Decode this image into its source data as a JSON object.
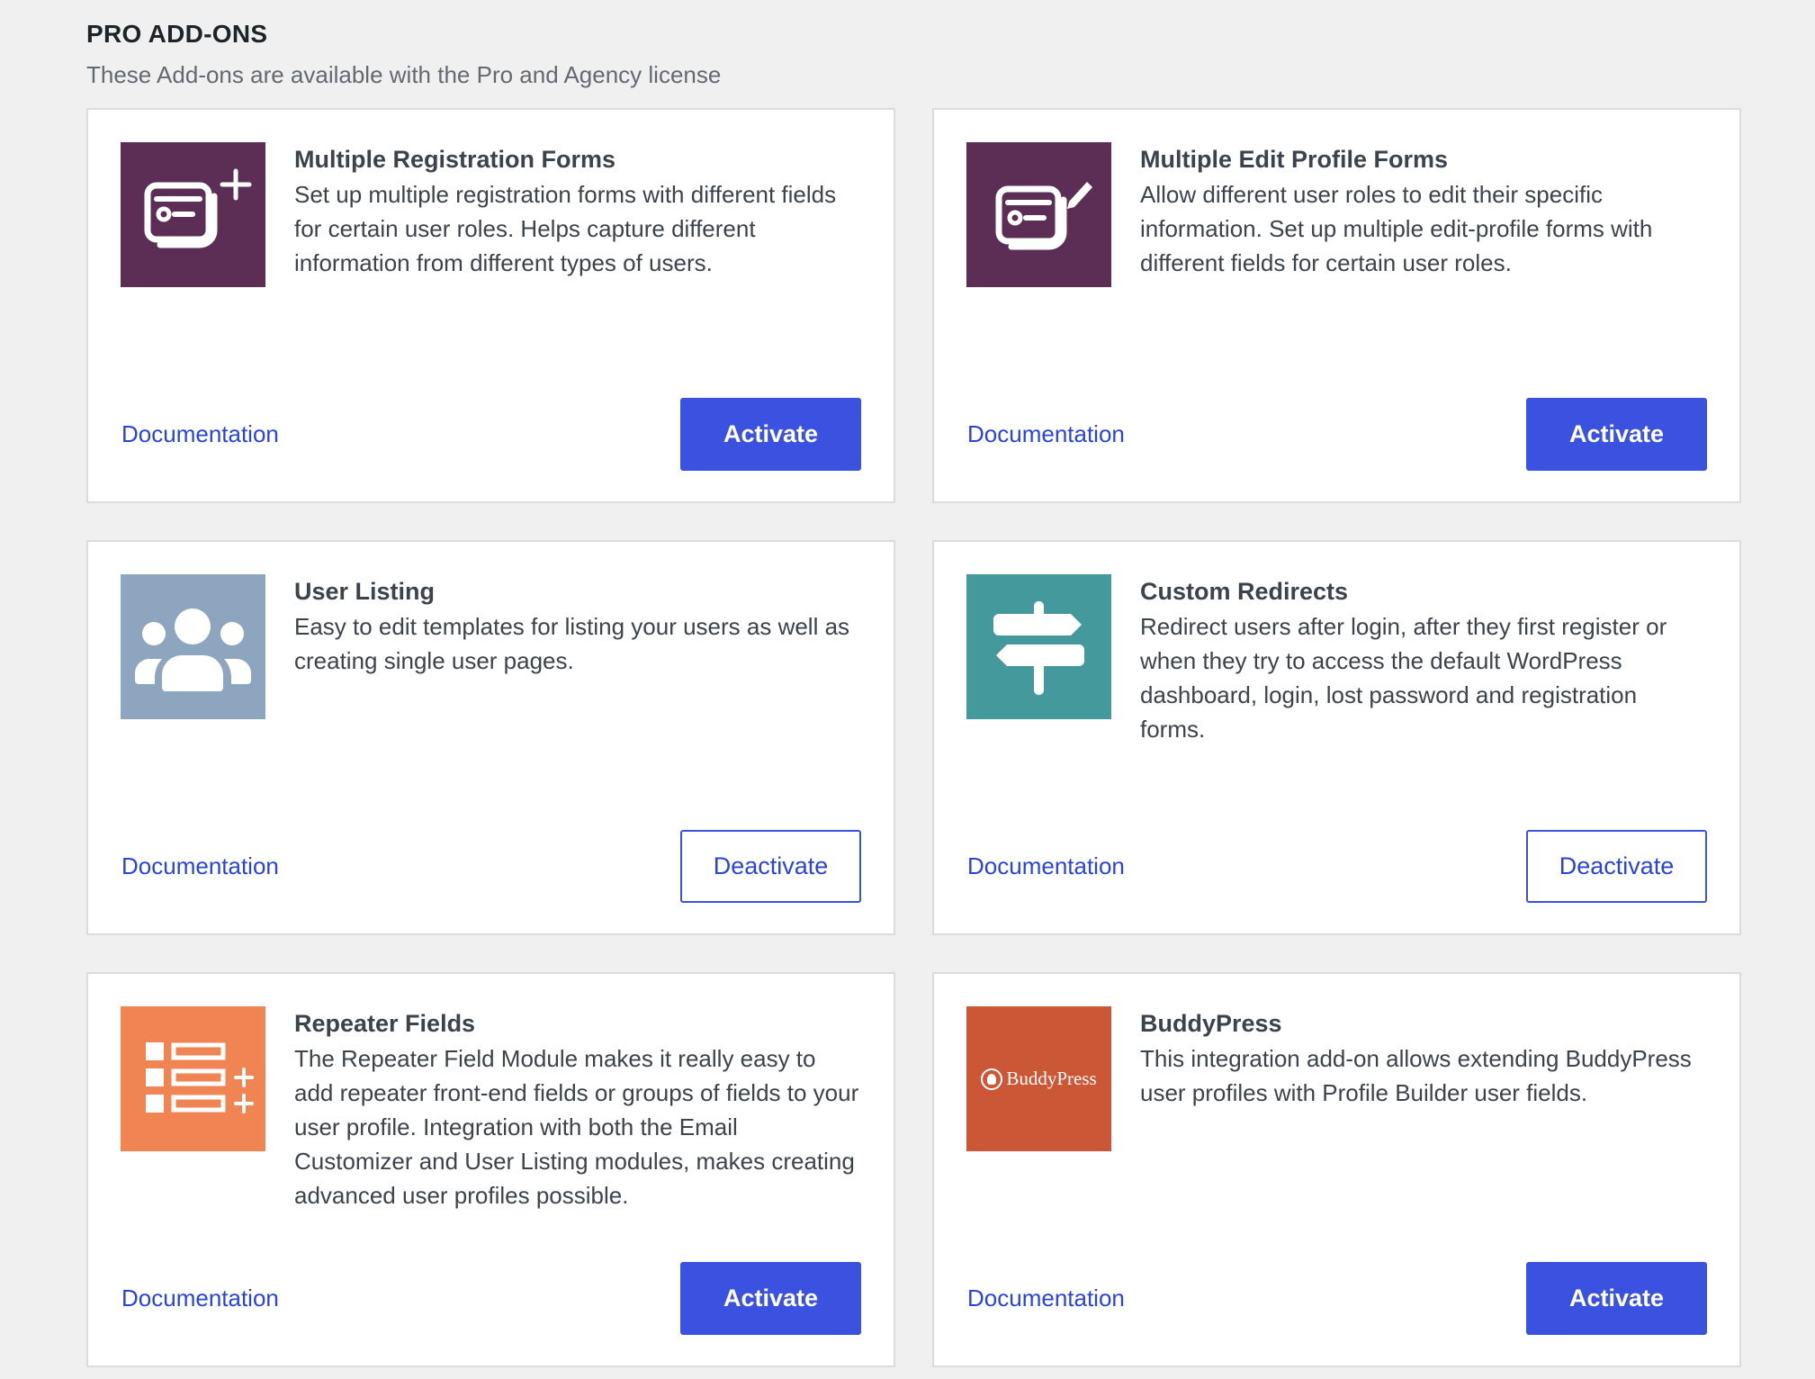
{
  "header": {
    "title": "PRO ADD-ONS",
    "subtitle": "These Add-ons are available with the Pro and Agency license"
  },
  "colors": {
    "primary_button": "#3b52e0",
    "link": "#2a44d6",
    "purple_thumb": "#5c2d55",
    "slate_thumb": "#8ea5bf",
    "teal_thumb": "#43999b",
    "orange_thumb": "#f08453",
    "buddypress_thumb": "#cc5737"
  },
  "addons": [
    {
      "title": "Multiple Registration Forms",
      "description": "Set up multiple registration forms with different fields for certain user roles. Helps capture different information from different types of users.",
      "doc_label": "Documentation",
      "action_label": "Activate",
      "action_state": "inactive",
      "icon": "form-plus-icon"
    },
    {
      "title": "Multiple Edit Profile Forms",
      "description": "Allow different user roles to edit their specific information. Set up multiple edit-profile forms with different fields for certain user roles.",
      "doc_label": "Documentation",
      "action_label": "Activate",
      "action_state": "inactive",
      "icon": "form-edit-icon"
    },
    {
      "title": "User Listing",
      "description": "Easy to edit templates for listing your users as well as creating single user pages.",
      "doc_label": "Documentation",
      "action_label": "Deactivate",
      "action_state": "active",
      "icon": "users-group-icon"
    },
    {
      "title": "Custom Redirects",
      "description": "Redirect users after login, after they first register or when they try to access the default WordPress dashboard, login, lost password and registration forms.",
      "doc_label": "Documentation",
      "action_label": "Deactivate",
      "action_state": "active",
      "icon": "signpost-icon"
    },
    {
      "title": "Repeater Fields",
      "description": "The Repeater Field Module makes it really easy to add repeater front-end fields or groups of fields to your user profile. Integration with both the Email Customizer and User Listing modules, makes creating advanced user profiles possible.",
      "doc_label": "Documentation",
      "action_label": "Activate",
      "action_state": "inactive",
      "icon": "repeater-list-icon"
    },
    {
      "title": "BuddyPress",
      "description": "This integration add-on allows extending BuddyPress user profiles with Profile Builder user fields.",
      "doc_label": "Documentation",
      "action_label": "Activate",
      "action_state": "inactive",
      "icon": "buddypress-logo-icon",
      "logo_text": "BuddyPress"
    }
  ]
}
